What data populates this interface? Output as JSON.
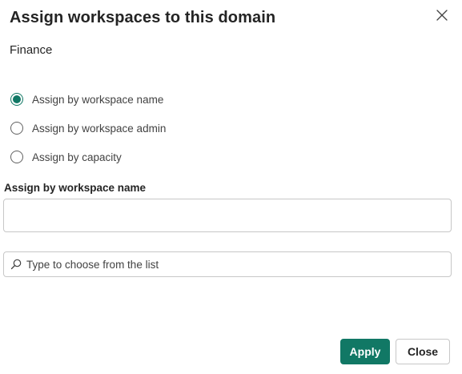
{
  "dialog": {
    "title": "Assign workspaces to this domain",
    "subtitle": "Finance",
    "close_icon": "close-icon"
  },
  "assign_options": {
    "selected": 0,
    "items": [
      {
        "label": "Assign by workspace name",
        "checked": true
      },
      {
        "label": "Assign by workspace admin",
        "checked": false
      },
      {
        "label": "Assign by capacity",
        "checked": false
      }
    ]
  },
  "section": {
    "label": "Assign by workspace name",
    "name_box_value": ""
  },
  "search": {
    "placeholder": "Type to choose from the list",
    "value": "",
    "icon": "search-icon"
  },
  "footer": {
    "apply_label": "Apply",
    "close_label": "Close"
  },
  "colors": {
    "accent": "#117865",
    "border": "#c7c7c7",
    "text": "#242424"
  }
}
